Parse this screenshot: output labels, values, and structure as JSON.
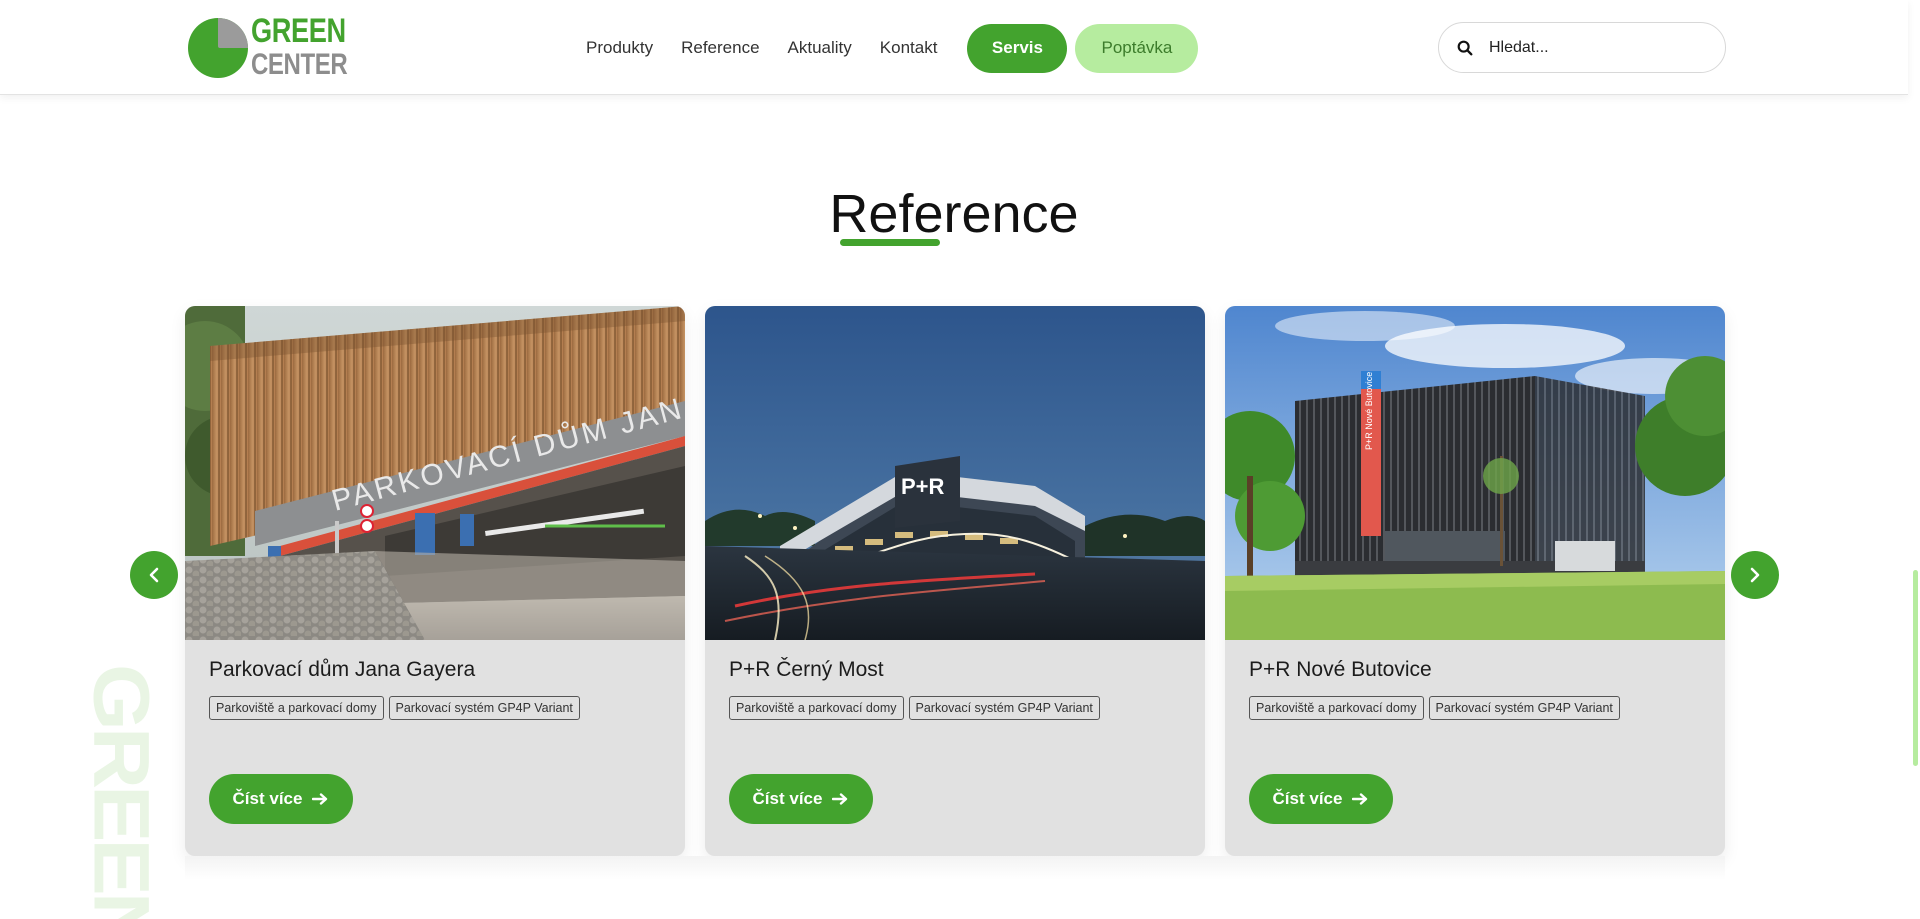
{
  "header": {
    "logo": {
      "line1": "GREEN",
      "line2": "CENTER"
    },
    "nav": [
      {
        "label": "Produkty"
      },
      {
        "label": "Reference"
      },
      {
        "label": "Aktuality"
      },
      {
        "label": "Kontakt"
      }
    ],
    "servis_label": "Servis",
    "poptavka_label": "Poptávka",
    "search": {
      "placeholder": "Hledat..."
    },
    "colors": {
      "brand_green": "#43a32e",
      "light_green": "#b6ec9f"
    }
  },
  "section": {
    "title": "Reference",
    "decor_text": "GREEN"
  },
  "carousel": {
    "prev_icon": "chevron-left-icon",
    "next_icon": "chevron-right-icon",
    "cards": [
      {
        "title": "Parkovací dům Jana Gayera",
        "tags": [
          "Parkoviště a parkovací domy",
          "Parkovací systém GP4P Variant"
        ],
        "button_label": "Číst více",
        "image_signage": "PARKOVACÍ DŮM JANA GAYERA"
      },
      {
        "title": "P+R Černý Most",
        "tags": [
          "Parkoviště a parkovací domy",
          "Parkovací systém GP4P Variant"
        ],
        "button_label": "Číst více",
        "image_signage": "P+R"
      },
      {
        "title": "P+R Nové Butovice",
        "tags": [
          "Parkoviště a parkovací domy",
          "Parkovací systém GP4P Variant"
        ],
        "button_label": "Číst více",
        "image_signage": "P+R Nové Butovice"
      }
    ]
  }
}
